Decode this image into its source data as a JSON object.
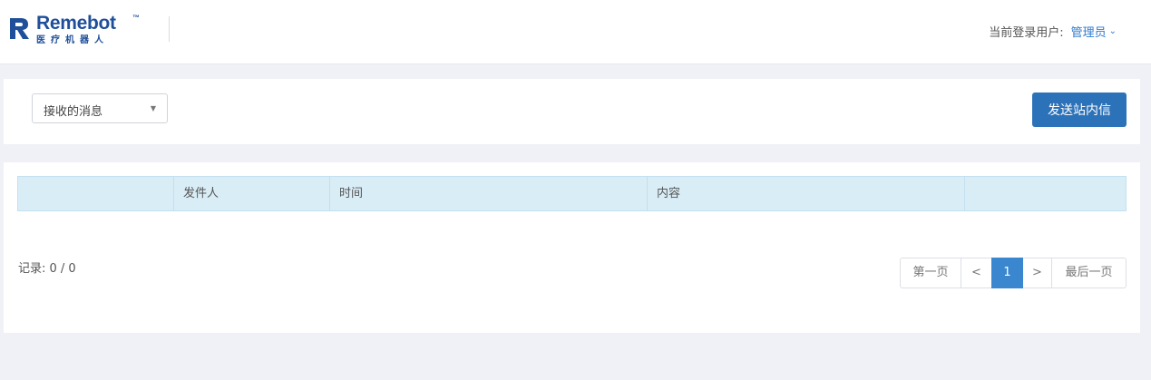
{
  "header": {
    "logo": {
      "brand": "Remebot",
      "trademark": "™",
      "subtitle": "医疗机器人"
    },
    "user_label": "当前登录用户:",
    "user_name": "管理员",
    "user_caret_icon": "chevron-down-icon"
  },
  "filter": {
    "select_value": "接收的消息",
    "select_caret_icon": "caret-down-icon",
    "send_button_label": "发送站内信"
  },
  "table": {
    "columns": [
      "",
      "发件人",
      "时间",
      "内容",
      ""
    ],
    "rows": []
  },
  "footer": {
    "record_count": "记录: 0 / 0"
  },
  "pagination": {
    "first": "第一页",
    "prev": "<",
    "current": "1",
    "next": ">",
    "last": "最后一页"
  },
  "colors": {
    "brand": "#1f4f9a",
    "primary_button": "#2c72b8",
    "table_header": "#d9edf7",
    "active_page": "#3a87d0",
    "link": "#2f7bd0",
    "background": "#eff1f6"
  }
}
